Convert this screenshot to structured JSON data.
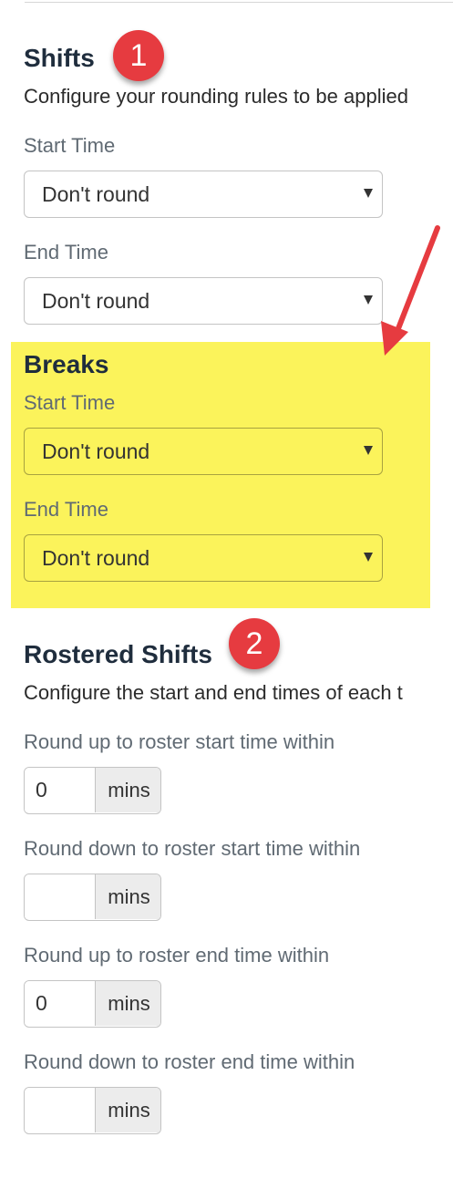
{
  "shifts": {
    "heading": "Shifts",
    "badge": "1",
    "description": "Configure your rounding rules to be applied",
    "start_time": {
      "label": "Start Time",
      "value": "Don't round"
    },
    "end_time": {
      "label": "End Time",
      "value": "Don't round"
    }
  },
  "breaks": {
    "heading": "Breaks",
    "start_time": {
      "label": "Start Time",
      "value": "Don't round"
    },
    "end_time": {
      "label": "End Time",
      "value": "Don't round"
    },
    "highlight_color": "#fbf35b"
  },
  "rostered_shifts": {
    "heading": "Rostered Shifts",
    "badge": "2",
    "description": "Configure the start and end times of each t",
    "fields": [
      {
        "label": "Round up to roster start time within",
        "value": "0",
        "unit": "mins"
      },
      {
        "label": "Round down to roster start time within",
        "value": "",
        "unit": "mins"
      },
      {
        "label": "Round up to roster end time within",
        "value": "0",
        "unit": "mins"
      },
      {
        "label": "Round down to roster end time within",
        "value": "",
        "unit": "mins"
      }
    ]
  },
  "annotations": {
    "badge_color": "#e63b40",
    "arrow_color": "#e63b40"
  }
}
